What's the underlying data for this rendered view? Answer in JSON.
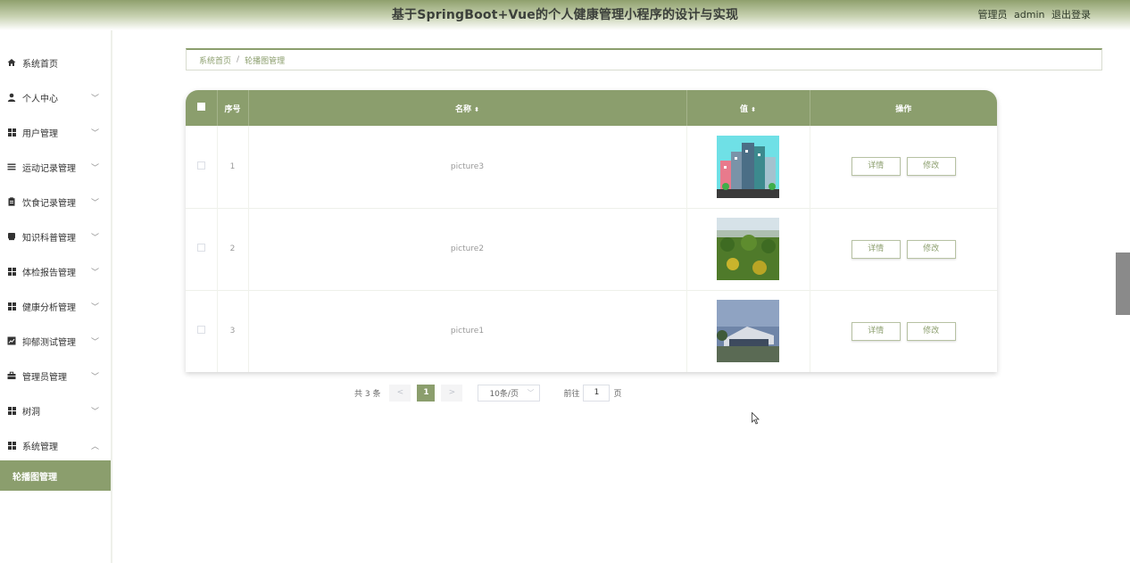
{
  "header": {
    "title": "基于SpringBoot+Vue的个人健康管理小程序的设计与实现",
    "role": "管理员",
    "username": "admin",
    "logout": "退出登录"
  },
  "sidebar": {
    "items": [
      {
        "label": "系统首页",
        "icon": "home-icon"
      },
      {
        "label": "个人中心",
        "icon": "user-icon",
        "chevron": "﹀"
      },
      {
        "label": "用户管理",
        "icon": "grid-icon",
        "chevron": "﹀"
      },
      {
        "label": "运动记录管理",
        "icon": "list-icon",
        "chevron": "﹀"
      },
      {
        "label": "饮食记录管理",
        "icon": "clipboard-icon",
        "chevron": "﹀"
      },
      {
        "label": "知识科普管理",
        "icon": "book-icon",
        "chevron": "﹀"
      },
      {
        "label": "体检报告管理",
        "icon": "grid-icon",
        "chevron": "﹀"
      },
      {
        "label": "健康分析管理",
        "icon": "grid-icon",
        "chevron": "﹀"
      },
      {
        "label": "抑郁测试管理",
        "icon": "chart-icon",
        "chevron": "﹀"
      },
      {
        "label": "管理员管理",
        "icon": "briefcase-icon",
        "chevron": "﹀"
      },
      {
        "label": "树洞",
        "icon": "grid-icon",
        "chevron": "﹀"
      },
      {
        "label": "系统管理",
        "icon": "grid-icon",
        "chevron": "︿"
      }
    ],
    "active_sub": "轮播图管理"
  },
  "breadcrumb": {
    "home": "系统首页",
    "separator": "/",
    "current": "轮播图管理"
  },
  "table": {
    "headers": {
      "index": "序号",
      "name": "名称",
      "value": "值",
      "actions": "操作"
    },
    "rows": [
      {
        "index": "1",
        "name": "picture3",
        "image": "city-buildings-illustration"
      },
      {
        "index": "2",
        "name": "picture2",
        "image": "green-field-landscape"
      },
      {
        "index": "3",
        "name": "picture1",
        "image": "modern-building-plaza"
      }
    ],
    "detail_label": "详情",
    "edit_label": "修改"
  },
  "pagination": {
    "total": "共 3 条",
    "prev": "<",
    "current": "1",
    "next": ">",
    "page_size": "10条/页",
    "goto_prefix": "前往",
    "goto_value": "1",
    "goto_suffix": "页"
  },
  "colors": {
    "accent": "#8b9e6d"
  }
}
